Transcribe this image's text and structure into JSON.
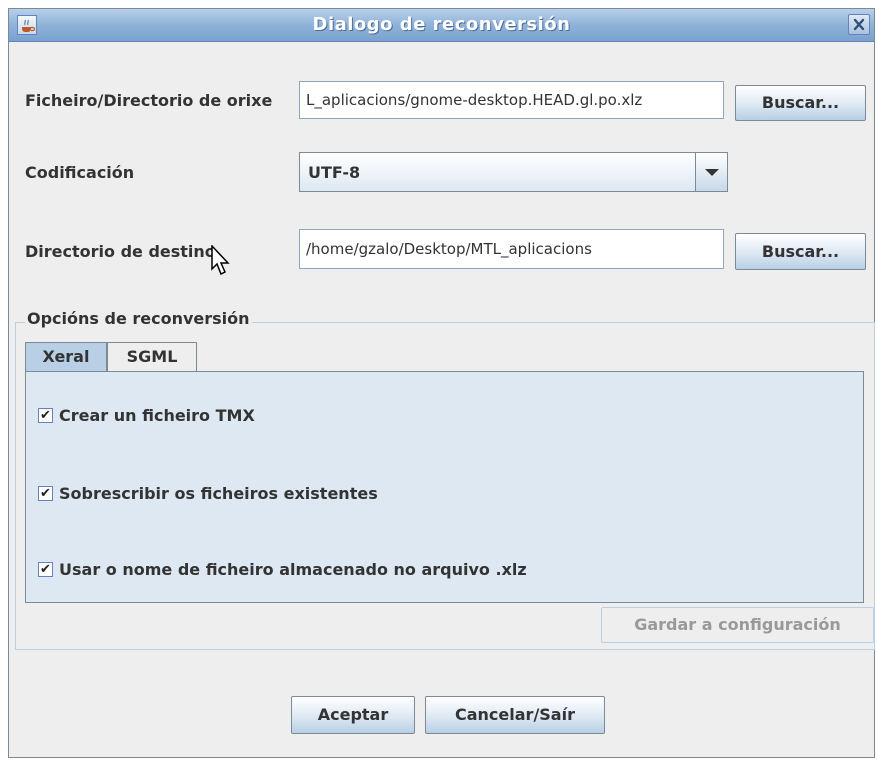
{
  "window": {
    "title": "Dialogo de reconversión"
  },
  "form": {
    "source": {
      "label": "Ficheiro/Directorio de orixe",
      "value": "L_aplicacions/gnome-desktop.HEAD.gl.po.xlz",
      "browse_label": "Buscar..."
    },
    "encoding": {
      "label": "Codificación",
      "value": "UTF-8"
    },
    "destination": {
      "label": "Directorio de destino",
      "value": "/home/gzalo/Desktop/MTL_aplicacions",
      "browse_label": "Buscar..."
    }
  },
  "options": {
    "group_title": "Opcións de reconversión",
    "tabs": [
      {
        "label": "Xeral",
        "active": true
      },
      {
        "label": "SGML",
        "active": false
      }
    ],
    "checkboxes": [
      {
        "label": "Crear un ficheiro TMX",
        "checked": true,
        "mark": "✔"
      },
      {
        "label": "Sobrescribir os ficheiros existentes",
        "checked": true,
        "mark": "✔"
      },
      {
        "label": "Usar o nome de ficheiro almacenado no arquivo .xlz",
        "checked": true,
        "mark": "✔"
      }
    ],
    "save_config_label": "Gardar a configuración"
  },
  "footer": {
    "accept_label": "Aceptar",
    "cancel_label": "Cancelar/Saír"
  },
  "icons": {
    "app": "java-cup-icon",
    "close": "close-icon",
    "dropdown": "chevron-down-icon",
    "cursor": "mouse-pointer-icon"
  }
}
